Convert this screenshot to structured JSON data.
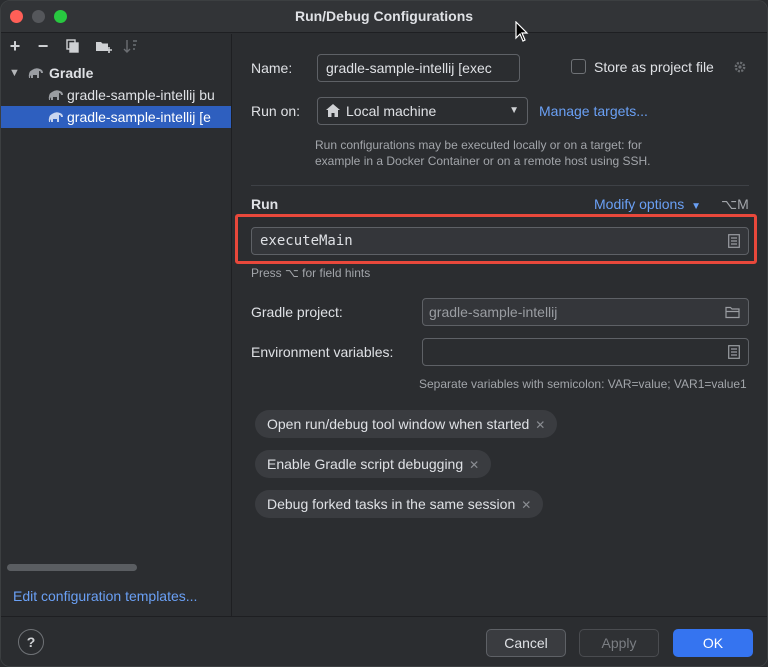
{
  "window": {
    "title": "Run/Debug Configurations"
  },
  "toolbar": {
    "add": "+",
    "remove": "−",
    "copy": "",
    "folder": "",
    "sort": ""
  },
  "tree": {
    "root_label": "Gradle",
    "items": [
      {
        "label": "gradle-sample-intellij bu",
        "selected": false
      },
      {
        "label": "gradle-sample-intellij [e",
        "selected": true
      }
    ]
  },
  "edit_templates": "Edit configuration templates...",
  "form": {
    "name_label": "Name:",
    "name_value": "gradle-sample-intellij [exec",
    "store_label": "Store as project file",
    "run_on_label": "Run on:",
    "run_on_value": "Local machine",
    "manage_targets": "Manage targets...",
    "run_on_hint_1": "Run configurations may be executed locally or on a target: for",
    "run_on_hint_2": "example in a Docker Container or on a remote host using SSH.",
    "run_section": "Run",
    "modify_options": "Modify options",
    "modify_shortcut": "⌥M",
    "task_value": "executeMain",
    "field_hint": "Press ⌥ for field hints",
    "gradle_project_label": "Gradle project:",
    "gradle_project_value": "gradle-sample-intellij",
    "env_label": "Environment variables:",
    "env_value": "",
    "env_hint": "Separate variables with semicolon: VAR=value; VAR1=value1",
    "chips": [
      "Open run/debug tool window when started",
      "Enable Gradle script debugging",
      "Debug forked tasks in the same session"
    ]
  },
  "buttons": {
    "help": "?",
    "cancel": "Cancel",
    "apply": "Apply",
    "ok": "OK"
  },
  "colors": {
    "accent": "#3574f0",
    "link": "#6aa0f5",
    "highlight": "#e8483b",
    "selection": "#2e5fbf"
  }
}
